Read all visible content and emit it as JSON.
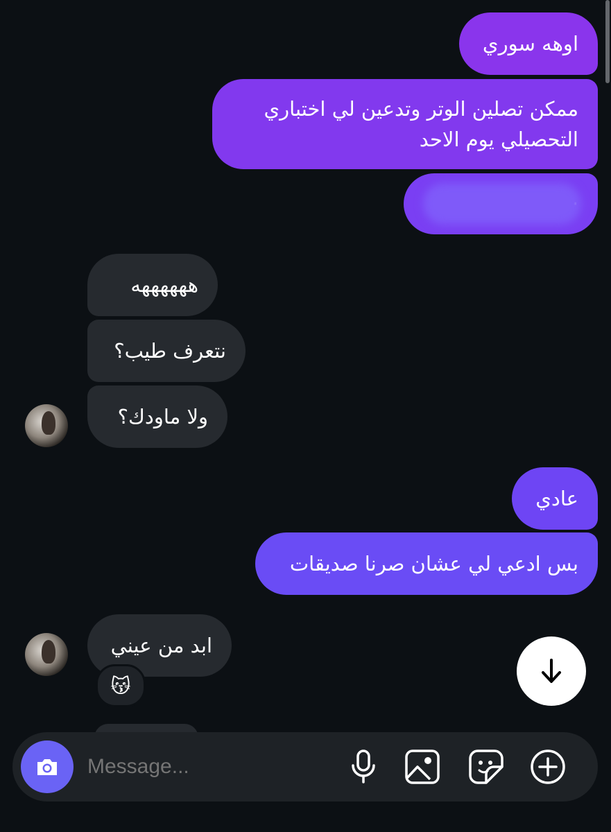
{
  "messages": {
    "out1": "اوهه سوري",
    "out2_line1": "ممكن تصلين الوتر وتدعين لي اختباري",
    "out2_line2": "التحصيلي يوم الاحد",
    "out3": "·",
    "in1": "ههههههه",
    "in2": "نتعرف طيب؟",
    "in3": "ولا ماودك؟",
    "out4": "عادي",
    "out5": "بس ادعي لي عشان صرنا صديقات",
    "in4": "ابد من عيني"
  },
  "reaction": {
    "emoji": "😽"
  },
  "composer": {
    "placeholder": "Message..."
  },
  "icons": {
    "camera": "camera-icon",
    "mic": "microphone-icon",
    "gallery": "image-icon",
    "sticker": "sticker-icon",
    "plus": "plus-icon",
    "scroll_down": "arrow-down-icon"
  },
  "colors": {
    "background": "#0c1014",
    "outgoing_bubble": "#7b3ff2",
    "incoming_bubble": "#262a2f",
    "camera_button": "#6a63f5"
  }
}
